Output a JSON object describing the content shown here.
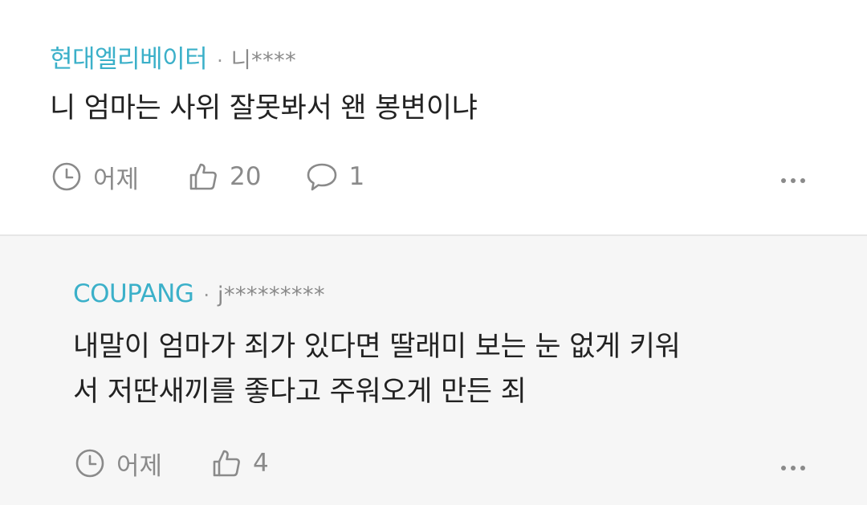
{
  "comments": [
    {
      "author": "현대엘리베이터",
      "separator": "·",
      "user": "니****",
      "text_lines": [
        "니 엄마는 사위 잘못봐서 왠 봉변이냐"
      ],
      "time": "어제",
      "likes": "20",
      "replies": "1"
    },
    {
      "author": "COUPANG",
      "separator": "·",
      "user": "j*********",
      "text_lines": [
        "내말이 엄마가 죄가 있다면 딸래미 보는 눈 없게 키워",
        "서 저딴새끼를 좋다고 주워오게 만든 죄"
      ],
      "time": "어제",
      "likes": "4"
    }
  ],
  "icons": {
    "clock": "clock-icon",
    "like": "thumbs-up-icon",
    "reply": "speech-bubble-icon",
    "more": "more-horizontal-icon"
  },
  "colors": {
    "author": "#3bb0c9",
    "muted": "#8a8a8a",
    "reply_background": "#f6f6f6"
  }
}
